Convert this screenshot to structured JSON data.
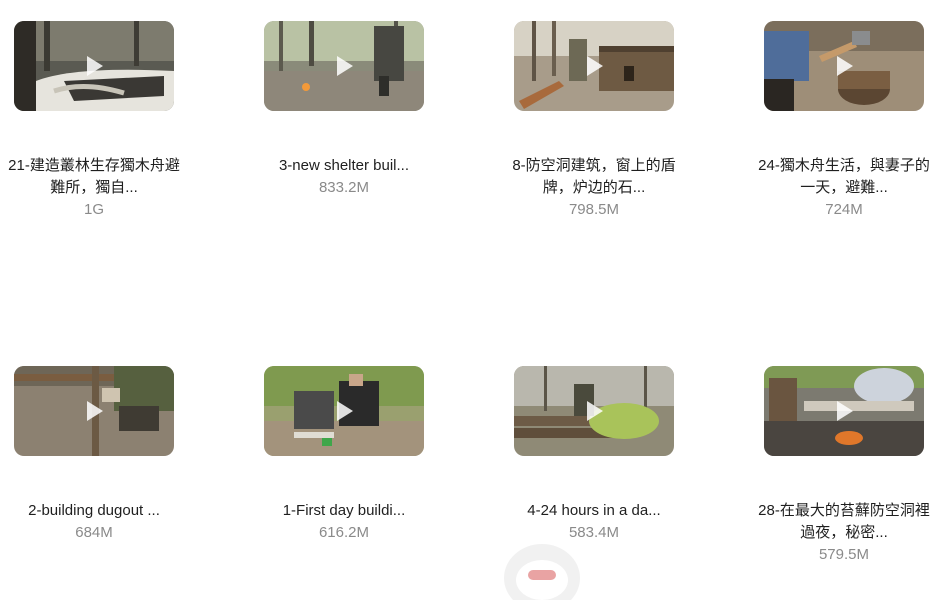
{
  "videos": [
    {
      "title": "21-建造叢林生存獨木舟避難所，獨自...",
      "size": "1G"
    },
    {
      "title": "3-new shelter buil...",
      "size": "833.2M"
    },
    {
      "title": "8-防空洞建筑，窗上的盾牌，炉边的石...",
      "size": "798.5M"
    },
    {
      "title": "24-獨木舟生活，與妻子的一天，避難...",
      "size": "724M"
    },
    {
      "title": "2-building dugout ...",
      "size": "684M"
    },
    {
      "title": "1-First day buildi...",
      "size": "616.2M"
    },
    {
      "title": "4-24 hours in a da...",
      "size": "583.4M"
    },
    {
      "title": "28-在最大的苔蘚防空洞裡過夜，秘密...",
      "size": "579.5M"
    }
  ],
  "icons": {
    "play": "play-icon",
    "floating": "floating-assistant-icon"
  },
  "colors": {
    "title": "#1f1f1f",
    "size": "#8a8a8a",
    "background": "#ffffff"
  }
}
